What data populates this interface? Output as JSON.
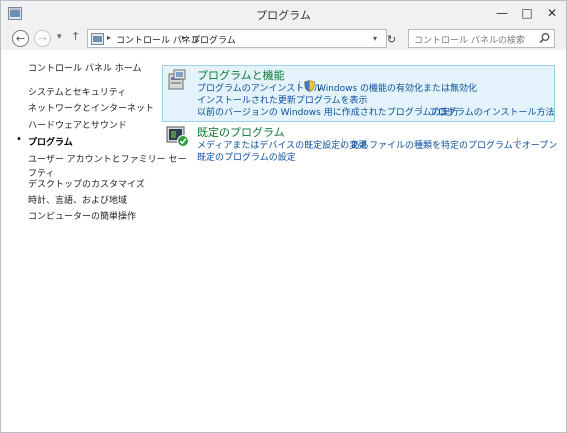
{
  "window": {
    "title": "プログラム",
    "minimize_label": "—",
    "maximize_label": "□",
    "close_label": "✕"
  },
  "nav": {
    "back_glyph": "←",
    "forward_glyph": "→",
    "dropdown_glyph": "▾",
    "up_glyph": "↑",
    "breadcrumb": [
      "コントロール パネル",
      "プログラム"
    ],
    "breadcrumb_separator": "▸",
    "refresh_glyph": "↻",
    "search_placeholder": "コントロール パネルの検索"
  },
  "sidebar": {
    "home": "コントロール パネル ホーム",
    "items": [
      {
        "label": "システムとセキュリティ",
        "current": false
      },
      {
        "label": "ネットワークとインターネット",
        "current": false
      },
      {
        "label": "ハードウェアとサウンド",
        "current": false
      },
      {
        "label": "プログラム",
        "current": true
      },
      {
        "label": "ユーザー アカウントとファミリー セーフティ",
        "current": false
      },
      {
        "label": "デスクトップのカスタマイズ",
        "current": false
      },
      {
        "label": "時計、言語、および地域",
        "current": false
      },
      {
        "label": "コンピューターの簡単操作",
        "current": false
      }
    ],
    "item4_line1": "ユーザー アカウントとファミリー セー",
    "item4_line2": "フティ",
    "bullet": "•"
  },
  "main": {
    "categories": [
      {
        "title": "プログラムと機能",
        "links": [
          "プログラムのアンインストール",
          "Windows の機能の有効化または無効化",
          "インストールされた更新プログラムを表示",
          "以前のバージョンの Windows 用に作成されたプログラムの実行",
          "プログラムのインストール方法"
        ]
      },
      {
        "title": "既定のプログラム",
        "links": [
          "メディアまたはデバイスの既定設定の変更",
          "あるファイルの種類を特定のプログラムでオープン",
          "既定のプログラムの設定"
        ]
      }
    ],
    "separator": "|"
  },
  "colors": {
    "accent_green": "#0a7a35",
    "link_blue": "#0b4f9e",
    "highlight_bg": "#e4f3fb",
    "highlight_border": "#9dd0ea"
  }
}
